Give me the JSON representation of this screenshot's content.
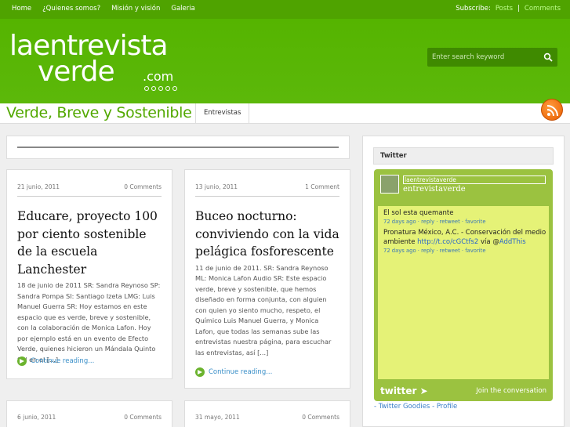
{
  "topnav": {
    "items": [
      "Home",
      "¿Quienes somos?",
      "Misión y visión",
      "Galeria"
    ],
    "subscribe_label": "Subscribe:",
    "posts_link": "Posts",
    "separator": "|",
    "comments_link": "Comments"
  },
  "header": {
    "logo_line1": "laentrevista",
    "logo_line2": "verde",
    "logo_com": ".com",
    "search_placeholder": "Enter search keyword"
  },
  "tagbar": {
    "tagline": "Verde, Breve y Sostenible",
    "tab": "Entrevistas"
  },
  "posts": [
    {
      "date": "21 junio, 2011",
      "comments": "0 Comments",
      "title": "Educare, proyecto 100 por ciento sostenible de la escuela Lanchester",
      "excerpt": "18 de junio de 2011   SR: Sandra Reynoso SP: Sandra Pompa SI: Santiago Izeta LMG: Luis Manuel Guerra SR: Hoy estamos en este espacio que es verde, breve y sostenible, con la colaboración de Monica Lafon. Hoy por ejemplo está en un evento de Efecto Verde, quienes hicieron un Mándala Quinto Sol en el [...]",
      "more": "Continue reading..."
    },
    {
      "date": "13 junio, 2011",
      "comments": "1 Comment",
      "title": "Buceo nocturno: conviviendo con la vida pelágica fosforescente",
      "excerpt": "11 de junio de 2011. SR: Sandra Reynoso ML: Monica Lafon Audio SR: Este espacio verde, breve y sostenible, que hemos diseñado en forma conjunta, con alguien con quien yo siento mucho, respeto, el Químico Luis Manuel Guerra, y Monica Lafon, que todas las semanas sube las entrevistas nuestra página, para escuchar las entrevistas, así [...]",
      "more": "Continue reading..."
    },
    {
      "date": "6 junio, 2011",
      "comments": "0 Comments"
    },
    {
      "date": "31 mayo, 2011",
      "comments": "0 Comments"
    }
  ],
  "sidebar": {
    "title": "Twitter",
    "twitter": {
      "username": "laentrevistaverde",
      "handle": "entrevistaverde",
      "tweets": [
        {
          "text": "El sol esta quemante",
          "meta": "72 days ago · reply · retweet · favorite"
        },
        {
          "text_before": "Pronatura México, A.C. - Conservación del medio ambiente ",
          "link": "http://t.co/cGCtfs2",
          "text_mid": " vía @",
          "mention": "AddThis",
          "meta": "72 days ago · reply · retweet · favorite"
        }
      ],
      "logo": "twitter",
      "join": "Join the conversation"
    },
    "goodies": "- Twitter Goodies - Profile"
  },
  "colors": {
    "brand_green": "#55b400",
    "nav_green": "#4fa300",
    "link_blue": "#3a8fc8",
    "widget_green": "#9bc240",
    "widget_yellow": "#e5f277"
  }
}
